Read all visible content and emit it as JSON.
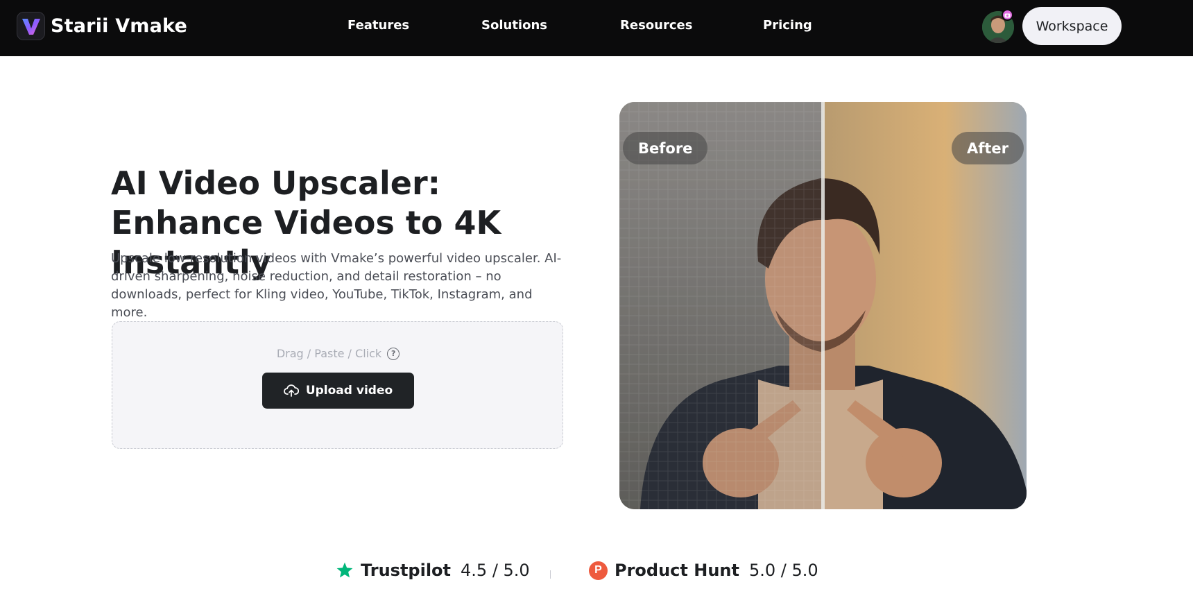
{
  "nav": {
    "brand": "Starii Vmake",
    "links": [
      {
        "label": "Features"
      },
      {
        "label": "Solutions"
      },
      {
        "label": "Resources"
      },
      {
        "label": "Pricing"
      }
    ],
    "workspace_label": "Workspace",
    "icons": {
      "logo": "vmake-logo",
      "avatar": "user-avatar",
      "badge": "camera-badge-icon"
    }
  },
  "hero": {
    "title": "AI Video Upscaler: Enhance Videos to 4K Instantly",
    "description": "Upscale low-resolution videos with Vmake’s powerful video upscaler. AI-driven sharpening, noise reduction, and detail restoration – no downloads, perfect for Kling video, YouTube, TikTok, Instagram, and more.",
    "upload": {
      "hint": "Drag / Paste / Click",
      "button_label": "Upload video",
      "icons": {
        "help": "question-circle-icon",
        "upload": "cloud-upload-icon"
      }
    }
  },
  "compare": {
    "before_label": "Before",
    "after_label": "After",
    "divider_position": 0.5
  },
  "ratings": [
    {
      "name": "Trustpilot",
      "score": "4.5 / 5.0",
      "icon": "star-icon"
    },
    {
      "name": "Product Hunt",
      "score": "5.0 / 5.0",
      "icon": "product-hunt-icon",
      "icon_letter": "P"
    }
  ],
  "colors": {
    "topbar": "#0b0b0c",
    "upload_button": "#202326",
    "trustpilot_green": "#00b67a",
    "product_hunt_orange": "#ee5a3e"
  }
}
